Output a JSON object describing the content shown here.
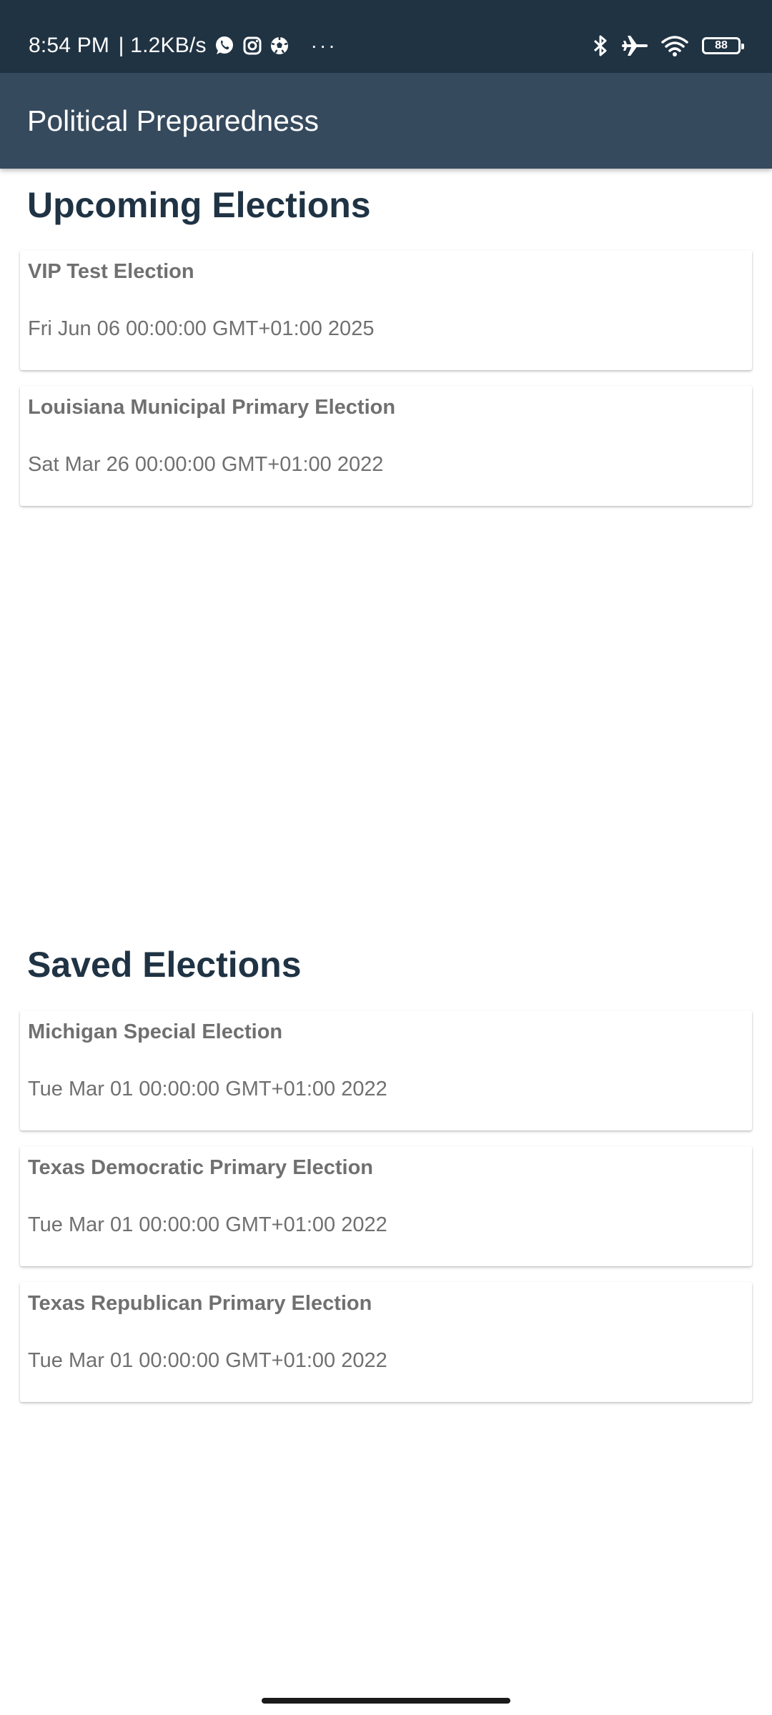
{
  "status_bar": {
    "time": "8:54 PM",
    "network_speed": "1.2KB/s",
    "notification_icons": [
      "whatsapp-icon",
      "instagram-icon",
      "soccer-ball-icon"
    ],
    "more": "···",
    "battery_level": "88",
    "system_icons": [
      "bluetooth-icon",
      "airplane-icon",
      "wifi-icon",
      "battery-icon"
    ]
  },
  "app_bar": {
    "title": "Political Preparedness"
  },
  "upcoming": {
    "heading": "Upcoming Elections",
    "items": [
      {
        "name": "VIP Test Election",
        "date": "Fri Jun 06 00:00:00 GMT+01:00 2025"
      },
      {
        "name": "Louisiana Municipal Primary Election",
        "date": "Sat Mar 26 00:00:00 GMT+01:00 2022"
      }
    ]
  },
  "saved": {
    "heading": "Saved Elections",
    "items": [
      {
        "name": "Michigan Special Election",
        "date": "Tue Mar 01 00:00:00 GMT+01:00 2022"
      },
      {
        "name": "Texas Democratic Primary Election",
        "date": "Tue Mar 01 00:00:00 GMT+01:00 2022"
      },
      {
        "name": "Texas Republican Primary Election",
        "date": "Tue Mar 01 00:00:00 GMT+01:00 2022"
      }
    ]
  },
  "colors": {
    "status_bar_bg": "#203343",
    "app_bar_bg": "#364a5e",
    "heading_text": "#1f3344",
    "card_text": "#707070"
  }
}
